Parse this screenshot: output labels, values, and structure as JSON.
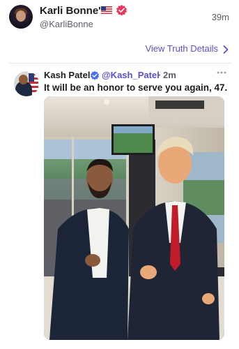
{
  "header": {
    "display_name": "Karli Bonne'",
    "flag_icon": "us-flag-icon",
    "verified_icon": "verified-badge-icon",
    "handle": "@KarliBonne",
    "time_ago": "39m",
    "avatar_text": "Karli Bonne'"
  },
  "actions": {
    "view_details_label": "View Truth Details",
    "view_details_icon": "chevron-right-icon"
  },
  "embedded_post": {
    "author_name": "Kash Patel",
    "verified_icon": "verified-badge-icon",
    "handle": "@Kash_Patel",
    "separator": "·",
    "time_ago": "2m",
    "more_icon": "ellipsis-icon",
    "text": "It will be an honor to serve you again, 47.",
    "photo_alt": "Two men in suits posing in a stadium suite, one in a dark jacket giving a thumbs up, the other in a navy suit with red tie giving a thumbs up"
  },
  "colors": {
    "accent": "#5a4fcf",
    "verified": "#e8375a",
    "text_primary": "#1d1d21",
    "text_secondary": "#5e5e6b"
  }
}
